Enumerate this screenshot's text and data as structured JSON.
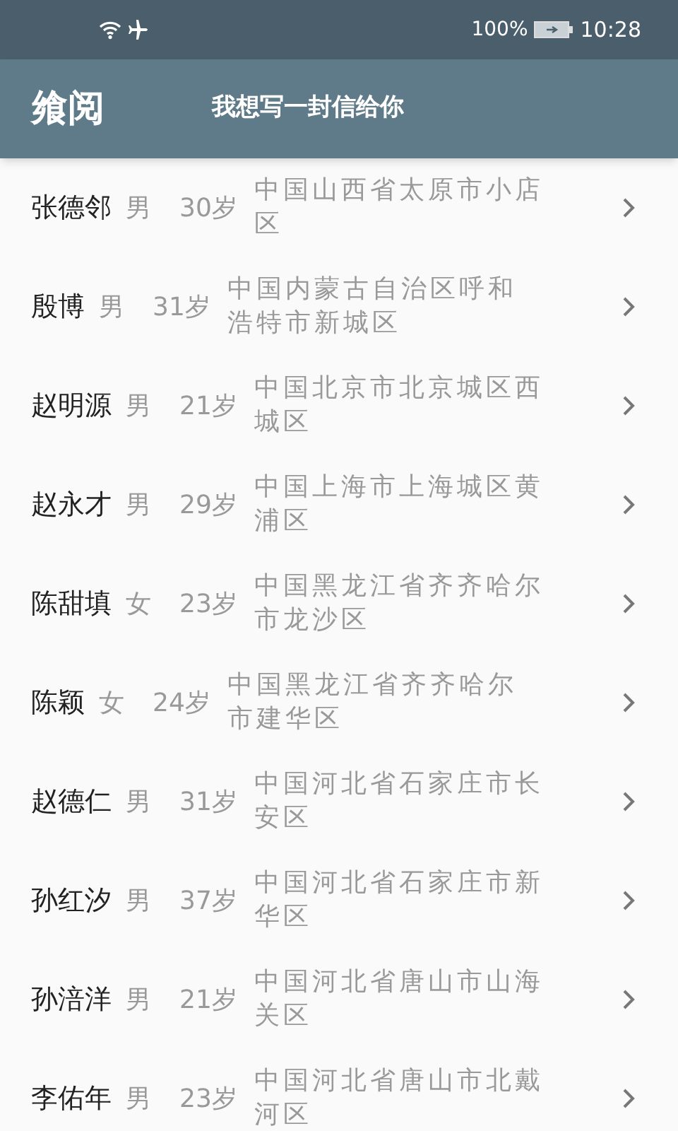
{
  "status_bar": {
    "battery": "100%",
    "time": "10:28"
  },
  "header": {
    "logo": "飨阅",
    "title": "我想写一封信给你"
  },
  "people": [
    {
      "name": "张德邻",
      "gender": "男",
      "age": "30岁",
      "address": "中国山西省太原市小店区"
    },
    {
      "name": "殷博",
      "gender": "男",
      "age": "31岁",
      "address": "中国内蒙古自治区呼和浩特市新城区"
    },
    {
      "name": "赵明源",
      "gender": "男",
      "age": "21岁",
      "address": "中国北京市北京城区西城区"
    },
    {
      "name": "赵永才",
      "gender": "男",
      "age": "29岁",
      "address": "中国上海市上海城区黄浦区"
    },
    {
      "name": "陈甜填",
      "gender": "女",
      "age": "23岁",
      "address": "中国黑龙江省齐齐哈尔市龙沙区"
    },
    {
      "name": "陈颖",
      "gender": "女",
      "age": "24岁",
      "address": "中国黑龙江省齐齐哈尔市建华区"
    },
    {
      "name": "赵德仁",
      "gender": "男",
      "age": "31岁",
      "address": "中国河北省石家庄市长安区"
    },
    {
      "name": "孙红汐",
      "gender": "男",
      "age": "37岁",
      "address": "中国河北省石家庄市新华区"
    },
    {
      "name": "孙涪洋",
      "gender": "男",
      "age": "21岁",
      "address": "中国河北省唐山市山海关区"
    },
    {
      "name": "李佑年",
      "gender": "男",
      "age": "23岁",
      "address": "中国河北省唐山市北戴河区"
    }
  ]
}
